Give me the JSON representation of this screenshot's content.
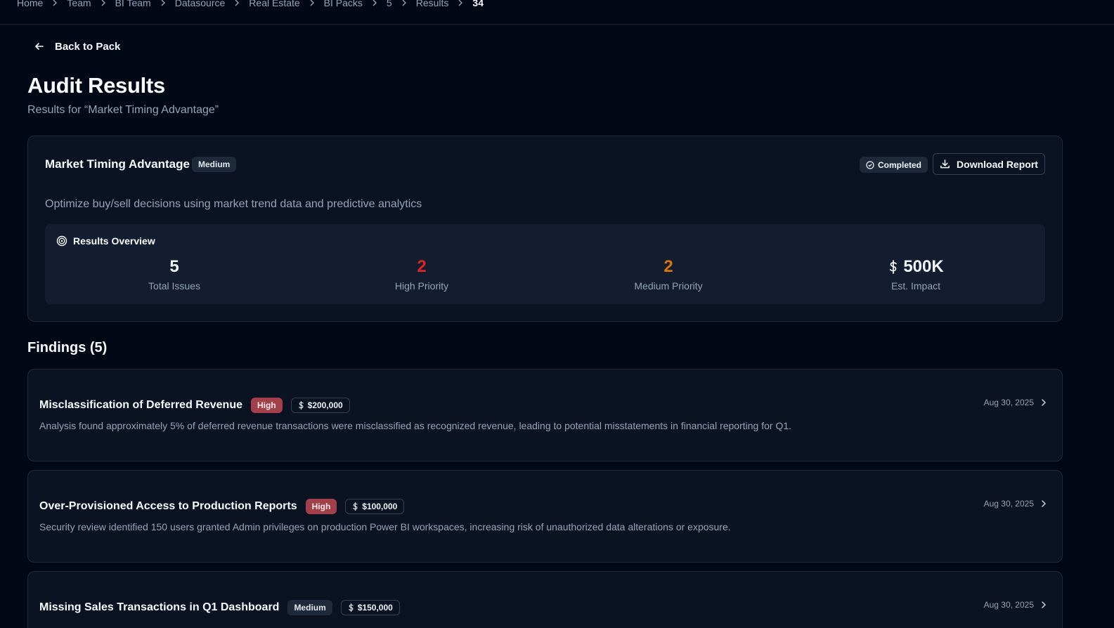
{
  "breadcrumb": [
    "Home",
    "Team",
    "BI Team",
    "Datasource",
    "Real Estate",
    "BI Packs",
    "5",
    "Results",
    "34"
  ],
  "back_label": "Back to Pack",
  "page": {
    "title": "Audit Results",
    "subtitle": "Results for “Market Timing Advantage”"
  },
  "pack": {
    "name": "Market Timing Advantage",
    "priority": "Medium",
    "status": "Completed",
    "download_label": "Download Report",
    "description": "Optimize buy/sell decisions using market trend data and predictive analytics"
  },
  "overview": {
    "heading": "Results Overview",
    "stats": [
      {
        "value": "5",
        "label": "Total Issues",
        "color": "#f8fafc"
      },
      {
        "value": "2",
        "label": "High Priority",
        "color": "#dc2626"
      },
      {
        "value": "2",
        "label": "Medium Priority",
        "color": "#d97706"
      },
      {
        "value": "500K",
        "label": "Est. Impact",
        "color": "#f8fafc"
      }
    ]
  },
  "findings": {
    "heading": "Findings (5)",
    "items": [
      {
        "title": "Misclassification of Deferred Revenue",
        "severity": "High",
        "impact": "$200,000",
        "description": "Analysis found approximately 5% of deferred revenue transactions were misclassified as recognized revenue, leading to potential misstatements in financial reporting for Q1.",
        "date": "Aug 30, 2025"
      },
      {
        "title": "Over-Provisioned Access to Production Reports",
        "severity": "High",
        "impact": "$100,000",
        "description": "Security review identified 150 users granted Admin privileges on production Power BI workspaces, increasing risk of unauthorized data alterations or exposure.",
        "date": "Aug 30, 2025"
      },
      {
        "title": "Missing Sales Transactions in Q1 Dashboard",
        "severity": "Medium",
        "impact": "$150,000",
        "description": "",
        "date": "Aug 30, 2025"
      }
    ]
  }
}
